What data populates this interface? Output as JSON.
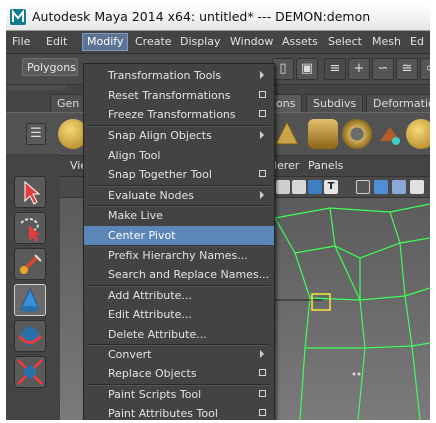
{
  "window": {
    "title": "Autodesk Maya 2014 x64: untitled*   ---   DEMON:demon"
  },
  "menubar": {
    "items": [
      "File",
      "Edit",
      "Modify",
      "Create",
      "Display",
      "Window",
      "Assets",
      "Select",
      "Mesh",
      "Ed"
    ],
    "active": "Modify"
  },
  "status_line": {
    "mode_selector": "Polygons"
  },
  "shelf_tabs": {
    "left_tab": "Gen",
    "tabs": [
      "ons",
      "Subdivs",
      "Deformatio"
    ]
  },
  "viewport_panel": {
    "menu_left": "Vie",
    "menu_renderer": "derer",
    "menu_panels": "Panels"
  },
  "modify_menu": {
    "groups": [
      [
        {
          "label": "Transformation Tools",
          "submenu": true
        },
        {
          "label": "Reset Transformations",
          "option_box": true
        },
        {
          "label": "Freeze Transformations",
          "option_box": true
        }
      ],
      [
        {
          "label": "Snap Align Objects",
          "submenu": true
        },
        {
          "label": "Align Tool"
        },
        {
          "label": "Snap Together Tool",
          "option_box": true
        }
      ],
      [
        {
          "label": "Evaluate Nodes",
          "submenu": true
        }
      ],
      [
        {
          "label": "Make Live"
        },
        {
          "label": "Center Pivot",
          "highlighted": true
        }
      ],
      [
        {
          "label": "Prefix Hierarchy Names..."
        },
        {
          "label": "Search and Replace Names..."
        }
      ],
      [
        {
          "label": "Add Attribute..."
        },
        {
          "label": "Edit Attribute..."
        },
        {
          "label": "Delete Attribute..."
        }
      ],
      [
        {
          "label": "Convert",
          "submenu": true
        },
        {
          "label": "Replace Objects",
          "option_box": true
        }
      ],
      [
        {
          "label": "Paint Scripts Tool",
          "option_box": true
        },
        {
          "label": "Paint Attributes Tool",
          "option_box": true
        }
      ]
    ]
  },
  "colors": {
    "highlight": "#5b86b8",
    "wireframe": "#3cff5a",
    "pivot": "#f0e040"
  }
}
